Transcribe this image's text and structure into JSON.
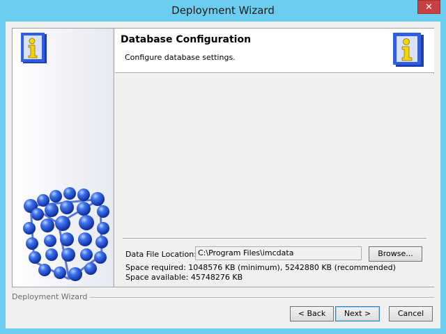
{
  "window": {
    "title": "Deployment Wizard",
    "close_label": "✕"
  },
  "header": {
    "title": "Database Configuration",
    "subtitle": "Configure database settings."
  },
  "form": {
    "data_file_label": "Data File Location:",
    "data_file_value": "C:\\Program Files\\imcdata",
    "browse_label": "Browse...",
    "space_required": "Space required: 1048576 KB (minimum), 5242880 KB (recommended)",
    "space_available": "Space available: 45748276 KB"
  },
  "footer": {
    "group_label": "Deployment Wizard",
    "back_label": "< Back",
    "next_label": "Next >",
    "cancel_label": "Cancel"
  },
  "colors": {
    "titlebar": "#6ccdf0",
    "close_button": "#c74141",
    "accent_blue": "#2a5fd6"
  },
  "icons": {
    "left_info": "info-book-icon",
    "right_info": "info-book-icon",
    "left_graphic": "molecule-sphere-graphic"
  }
}
